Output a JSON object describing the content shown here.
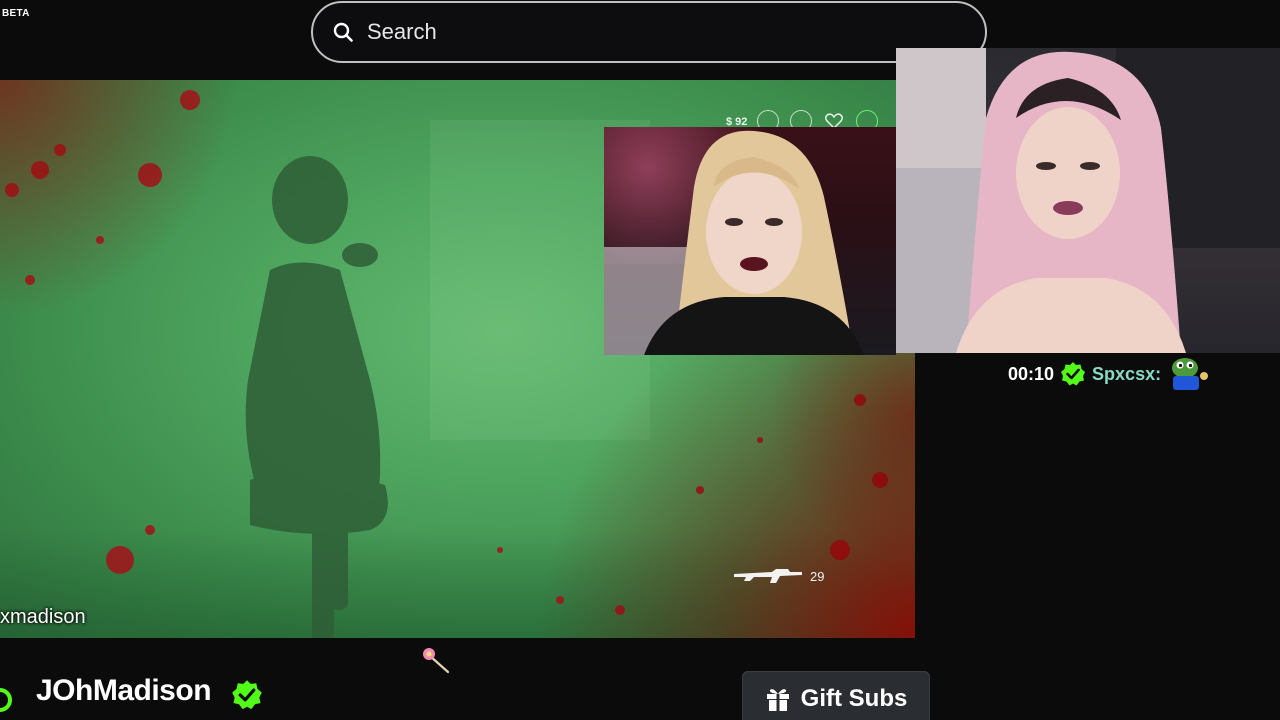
{
  "header": {
    "beta_label": "BETA",
    "search": {
      "placeholder": "Search",
      "value": ""
    }
  },
  "stream": {
    "game_hud": {
      "money": "$ 92",
      "ammo": "29"
    },
    "watermark": "xmadison"
  },
  "chat": {
    "messages": [
      {
        "time": "00:10",
        "username": "Spxcsx:",
        "emote": "pepe-emote-icon"
      }
    ]
  },
  "channel": {
    "name": "JOhMadison",
    "verified": true,
    "live": true
  },
  "actions": {
    "gift_subs_label": "Gift Subs"
  },
  "colors": {
    "accent_green": "#53fc18",
    "verified_green": "#53fc18",
    "chat_username": "#89d9c3",
    "search_border": "#bfbfbf",
    "gift_button_bg": "#2a2d31"
  }
}
